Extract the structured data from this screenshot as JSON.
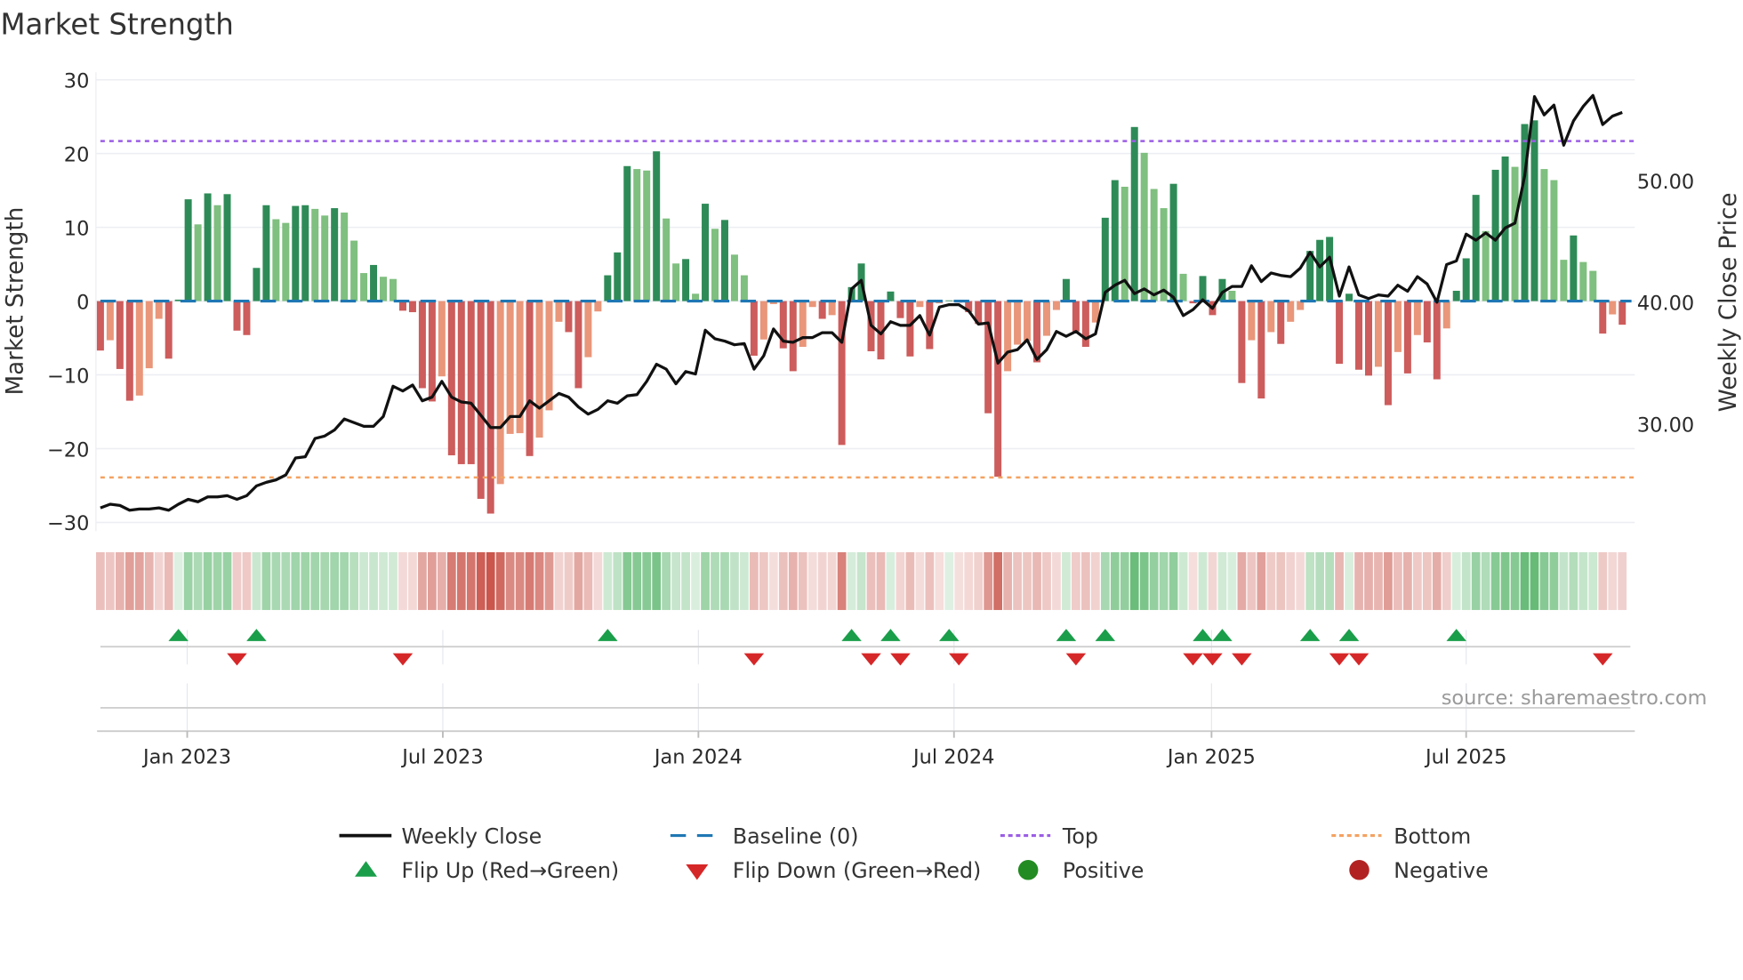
{
  "chart_data": {
    "type": "bar",
    "title": "Market Strength",
    "ylabel": "Market Strength",
    "y2label": "Weekly Close Price",
    "ylim": [
      -30,
      30
    ],
    "y2lim": [
      21.8,
      58.2
    ],
    "yticks": [
      "30",
      "20",
      "10",
      "0",
      "−10",
      "−20",
      "−30"
    ],
    "ytick_values": [
      30,
      20,
      10,
      0,
      -10,
      -20,
      -30
    ],
    "y2ticks": [
      "50.00",
      "40.00",
      "30.00"
    ],
    "y2tick_values": [
      50,
      40,
      30
    ],
    "xticks": [
      {
        "label": "Jan 2023",
        "week": 8.9
      },
      {
        "label": "Jul 2023",
        "week": 35.1
      },
      {
        "label": "Jan 2024",
        "week": 61.3
      },
      {
        "label": "Jul 2024",
        "week": 87.5
      },
      {
        "label": "Jan 2025",
        "week": 113.9
      },
      {
        "label": "Jul 2025",
        "week": 140.0
      }
    ],
    "top_level": 21.7,
    "bottom_level": -23.9,
    "baseline": 0,
    "strength": [
      -6.7,
      -5.3,
      -9.2,
      -13.5,
      -12.8,
      -9.1,
      -2.4,
      -7.8,
      0.2,
      13.8,
      10.4,
      14.6,
      13,
      14.5,
      -4,
      -4.6,
      4.5,
      13,
      11.1,
      10.6,
      12.9,
      13,
      12.5,
      11.6,
      12.6,
      12,
      8.2,
      3.8,
      4.9,
      3.3,
      3.0,
      -1.3,
      -1.5,
      -11.8,
      -13.6,
      -10.2,
      -20.9,
      -22.1,
      -22.1,
      -26.8,
      -28.8,
      -24.8,
      -18,
      -17.9,
      -21,
      -18.5,
      -14.8,
      -2.8,
      -4.2,
      -11.8,
      -7.6,
      -1.4,
      3.5,
      6.6,
      18.3,
      17.9,
      17.7,
      20.3,
      11.2,
      5.1,
      5.7,
      1.0,
      13.2,
      9.8,
      11,
      6.3,
      3.5,
      -7.4,
      -5.2,
      -0.4,
      -6.4,
      -9.5,
      -6.2,
      -0.8,
      -2.4,
      -1.9,
      -19.5,
      1.9,
      5.1,
      -6.8,
      -7.9,
      1.3,
      -2.3,
      -7.5,
      -0.8,
      -6.5,
      -0.3,
      0.1,
      -0.2,
      -1.5,
      -3.1,
      -15.2,
      -23.8,
      -9.5,
      -5.9,
      -5.4,
      -8.3,
      -4.7,
      -1.2,
      3.0,
      -4.1,
      -6.2,
      -2.9,
      11.3,
      16.4,
      15.5,
      23.6,
      20.1,
      15.2,
      12.6,
      15.9,
      3.7,
      -0.3,
      3.4,
      -1.9,
      3.0,
      1.4,
      -11.1,
      -5.3,
      -13.2,
      -4.2,
      -5.8,
      -2.8,
      -1.2,
      6.8,
      8.3,
      8.7,
      -8.5,
      1.0,
      -9.3,
      -10.1,
      -8.9,
      -14.1,
      -6.9,
      -9.8,
      -4.6,
      -5.6,
      -10.6,
      -3.7,
      1.4,
      5.8,
      14.4,
      9.5,
      17.8,
      19.6,
      18.2,
      24.0,
      24.5,
      17.9,
      16.4,
      5.6,
      8.9,
      5.3,
      4.1,
      -4.4,
      -1.8,
      -3.2
    ],
    "weekly_close": [
      23.1,
      23.4,
      23.3,
      22.9,
      23.0,
      23.0,
      23.1,
      22.9,
      23.4,
      23.8,
      23.6,
      24.0,
      24.0,
      24.1,
      23.8,
      24.1,
      24.9,
      25.2,
      25.4,
      25.8,
      27.2,
      27.3,
      28.8,
      29.0,
      29.5,
      30.4,
      30.1,
      29.8,
      29.8,
      30.6,
      33.1,
      32.7,
      33.2,
      31.9,
      32.2,
      33.5,
      32.2,
      31.8,
      31.7,
      30.7,
      29.7,
      29.7,
      30.6,
      30.6,
      31.9,
      31.3,
      31.9,
      32.5,
      32.2,
      31.4,
      30.8,
      31.2,
      31.9,
      31.7,
      32.3,
      32.4,
      33.5,
      34.9,
      34.5,
      33.3,
      34.3,
      34.1,
      37.7,
      37.0,
      36.8,
      36.5,
      36.6,
      34.5,
      35.6,
      37.8,
      36.8,
      36.7,
      37.1,
      37.1,
      37.5,
      37.5,
      36.7,
      41.1,
      41.8,
      38.1,
      37.4,
      38.4,
      38.1,
      38.1,
      38.9,
      37.3,
      39.6,
      39.8,
      39.8,
      39.3,
      38.2,
      38.3,
      35.0,
      35.9,
      36.1,
      36.9,
      35.3,
      36.1,
      37.6,
      37.2,
      37.6,
      37.0,
      37.4,
      40.8,
      41.4,
      41.8,
      40.7,
      41.1,
      40.6,
      41.0,
      40.4,
      38.9,
      39.4,
      40.2,
      39.5,
      40.8,
      41.3,
      41.3,
      43.0,
      41.7,
      42.4,
      42.2,
      42.1,
      42.8,
      44.1,
      42.9,
      43.7,
      40.5,
      42.9,
      40.6,
      40.3,
      40.6,
      40.5,
      41.4,
      40.9,
      42.1,
      41.5,
      40.0,
      43.1,
      43.4,
      45.6,
      45.1,
      45.7,
      45.1,
      46.1,
      46.5,
      50.4,
      56.9,
      55.4,
      56.2,
      52.9,
      54.9,
      56.1,
      57.0,
      54.6,
      55.3,
      55.6
    ],
    "flip_up_weeks": [
      8,
      16,
      52,
      77,
      81,
      87,
      99,
      103,
      113,
      115,
      124,
      128,
      139
    ],
    "flip_down_weeks": [
      14,
      31,
      67,
      79,
      82,
      88,
      100,
      112,
      114,
      117,
      127,
      129,
      154
    ],
    "legend": {
      "placement": "bottom",
      "items": [
        {
          "key": "close",
          "label": "Weekly Close"
        },
        {
          "key": "baseline",
          "label": "Baseline (0)"
        },
        {
          "key": "top",
          "label": "Top"
        },
        {
          "key": "bottom",
          "label": "Bottom"
        },
        {
          "key": "flip_up",
          "label": "Flip Up (Red→Green)"
        },
        {
          "key": "flip_down",
          "label": "Flip Down (Green→Red)"
        },
        {
          "key": "positive",
          "label": "Positive"
        },
        {
          "key": "negative",
          "label": "Negative"
        }
      ]
    },
    "source": "source: sharemaestro.com"
  },
  "colors": {
    "green_dark": "#2e8b57",
    "green_light": "#7fbf7f",
    "red_dark": "#cd5c5c",
    "red_light": "#e9967a",
    "close": "#111111",
    "baseline": "#1f77b4",
    "top": "#9b5de5",
    "bottom": "#f4a261",
    "flip_up": "#1a9e4a",
    "flip_down": "#d62728",
    "positive": "#228b22",
    "negative": "#b22222"
  }
}
